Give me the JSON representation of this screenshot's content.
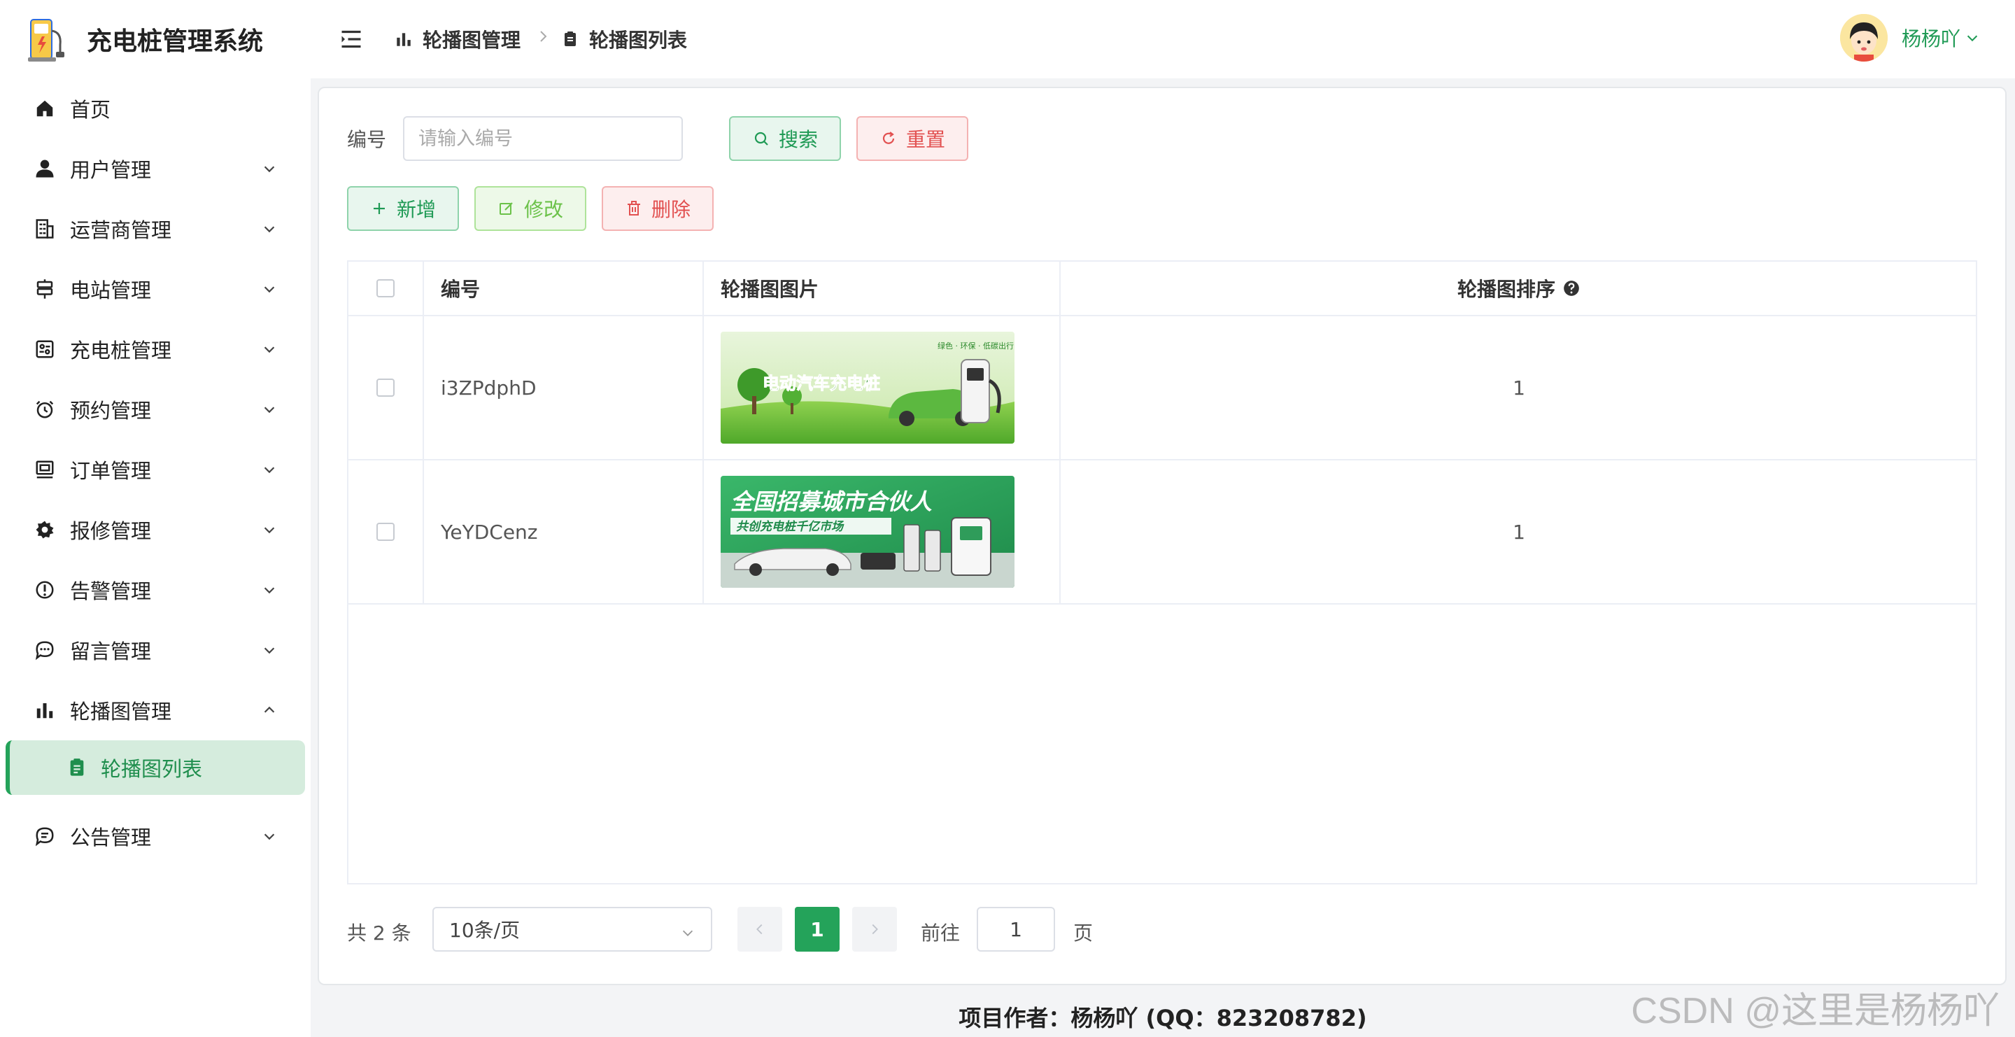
{
  "app": {
    "title": "充电桩管理系统"
  },
  "sidebar": {
    "items": [
      {
        "label": "首页",
        "icon": "home-icon"
      },
      {
        "label": "用户管理",
        "icon": "user-icon"
      },
      {
        "label": "运营商管理",
        "icon": "building-icon"
      },
      {
        "label": "电站管理",
        "icon": "station-icon"
      },
      {
        "label": "充电桩管理",
        "icon": "charger-icon"
      },
      {
        "label": "预约管理",
        "icon": "alarm-clock-icon"
      },
      {
        "label": "订单管理",
        "icon": "order-icon"
      },
      {
        "label": "报修管理",
        "icon": "gear-icon"
      },
      {
        "label": "告警管理",
        "icon": "warning-icon"
      },
      {
        "label": "留言管理",
        "icon": "message-icon"
      },
      {
        "label": "轮播图管理",
        "icon": "bar-chart-icon"
      },
      {
        "label": "公告管理",
        "icon": "notice-icon"
      }
    ],
    "active_sub": {
      "label": "轮播图列表",
      "icon": "clipboard-icon"
    }
  },
  "header": {
    "breadcrumb": [
      "轮播图管理",
      "轮播图列表"
    ],
    "username": "杨杨吖"
  },
  "filter": {
    "label": "编号",
    "placeholder": "请输入编号",
    "value": "",
    "search_label": "搜索",
    "reset_label": "重置"
  },
  "toolbar": {
    "add_label": "新增",
    "edit_label": "修改",
    "delete_label": "删除"
  },
  "table": {
    "columns": [
      "编号",
      "轮播图图片",
      "轮播图排序"
    ],
    "rows": [
      {
        "id": "i3ZPdphD",
        "image_text": "电动汽车充电桩",
        "image_tag": "绿色 · 环保 · 低碳出行",
        "sort": "1"
      },
      {
        "id": "YeYDCenz",
        "image_text": "全国招募城市合伙人",
        "image_tag": "共创充电桩千亿市场",
        "sort": "1"
      }
    ]
  },
  "pagination": {
    "total_text": "共 2 条",
    "page_size": "10条/页",
    "current_page": "1",
    "goto_label": "前往",
    "goto_value": "1",
    "page_unit": "页"
  },
  "footer": {
    "text": "项目作者：杨杨吖 (QQ：823208782)"
  },
  "watermark": {
    "text": "CSDN @这里是杨杨吖"
  },
  "colors": {
    "accent": "#24a35a",
    "danger": "#e25050",
    "edit": "#6cc24a"
  }
}
